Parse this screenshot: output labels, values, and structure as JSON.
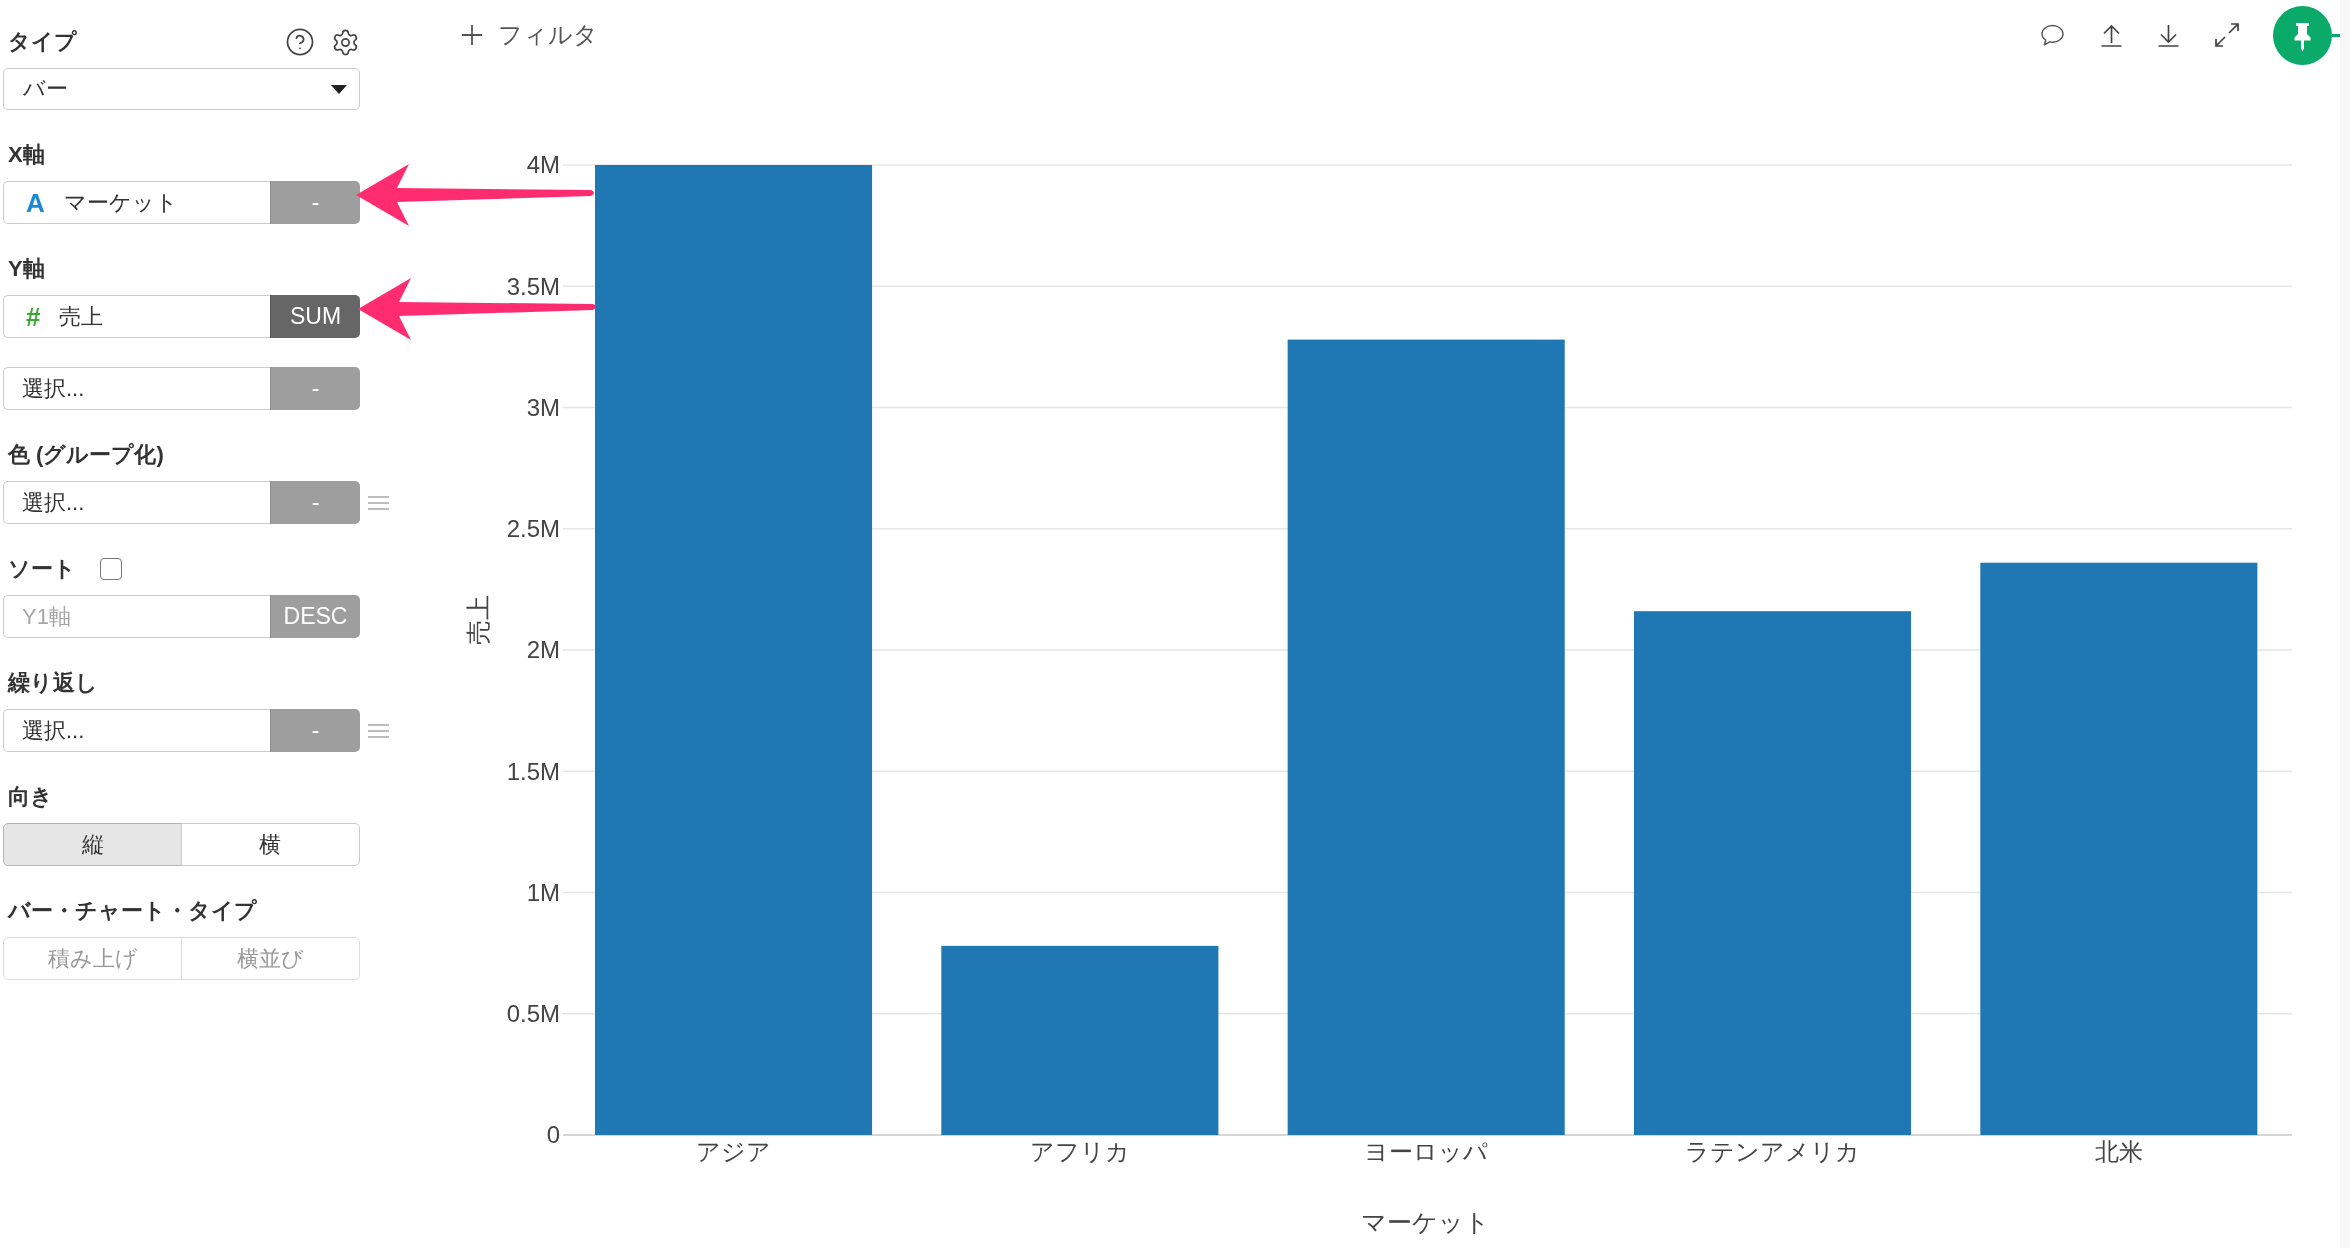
{
  "sidebar": {
    "chart_type": {
      "label": "タイプ",
      "value": "バー"
    },
    "sections": [
      {
        "label": "X軸",
        "fields": [
          {
            "color": "#1a8ad4",
            "type_mark": "A",
            "value": "マーケット",
            "action": {
              "label": "-",
              "active": false
            },
            "handle": false
          }
        ]
      },
      {
        "label": "Y軸",
        "fields": [
          {
            "color": "#3aaa35",
            "type_mark": "#",
            "value": "売上",
            "action": {
              "label": "SUM",
              "active": true
            },
            "handle": false
          },
          {
            "value": "選択...",
            "action": {
              "label": "-",
              "active": false
            },
            "handle": false
          }
        ]
      },
      {
        "label": "色 (グループ化)",
        "fields": [
          {
            "value": "選択...",
            "action": {
              "label": "-",
              "active": false
            },
            "handle": true
          }
        ]
      },
      {
        "label": "ソート",
        "checkbox": {
          "checked": false
        },
        "fields": [
          {
            "placeholder": "Y1軸",
            "action": {
              "label": "DESC",
              "active": false
            },
            "handle": false
          }
        ]
      },
      {
        "label": "繰り返し",
        "fields": [
          {
            "value": "選択...",
            "action": {
              "label": "-",
              "active": false
            },
            "handle": true
          }
        ]
      }
    ],
    "toggles": [
      {
        "label": "向き",
        "disabled": false,
        "options": [
          {
            "label": "縦",
            "selected": true
          },
          {
            "label": "横",
            "selected": false
          }
        ]
      },
      {
        "label": "バー・チャート・タイプ",
        "disabled": true,
        "options": [
          {
            "label": "積み上げ",
            "selected": false
          },
          {
            "label": "横並び",
            "selected": false
          }
        ]
      }
    ]
  },
  "toolbar": {
    "filter": {
      "label": "フィルタ"
    },
    "pinned": true
  },
  "chart": {
    "chart_data": {
      "type": "bar",
      "xlabel": "マーケット",
      "ylabel": "売上",
      "grid": true,
      "categories": [
        "アジア",
        "アフリカ",
        "ヨーロッパ",
        "ラテンアメリカ",
        "北米"
      ],
      "series": [
        {
          "color": "#1f77b4",
          "values": [
            4000000,
            780000,
            3280000,
            2160000,
            2360000
          ]
        }
      ],
      "ylim": [
        0,
        4000000
      ],
      "yticks": [
        {
          "value": 0,
          "label": "0"
        },
        {
          "value": 500000,
          "label": "0.5M"
        },
        {
          "value": 1000000,
          "label": "1M"
        },
        {
          "value": 1500000,
          "label": "1.5M"
        },
        {
          "value": 2000000,
          "label": "2M"
        },
        {
          "value": 2500000,
          "label": "2.5M"
        },
        {
          "value": 3000000,
          "label": "3M"
        },
        {
          "value": 3500000,
          "label": "3.5M"
        },
        {
          "value": 4000000,
          "label": "4M"
        }
      ]
    }
  }
}
